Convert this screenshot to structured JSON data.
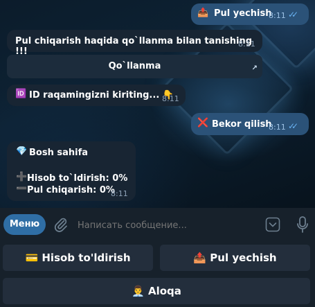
{
  "messages": {
    "pul_yechish": {
      "emoji": "📤",
      "text": "Pul yechish",
      "time": "8:11",
      "status": "✓✓"
    },
    "qollanma_info": {
      "text": "Pul chiqarish haqida qo`llanma bilan tanishing !!!",
      "time": "8:11",
      "button": "Qo`llanma",
      "button_icon": "↗"
    },
    "id_prompt": {
      "emoji": "🆔",
      "text": "ID raqamingizni kiriting... 👇",
      "time": "8:11"
    },
    "bekor": {
      "emoji": "❌",
      "text": "Bekor qilish",
      "time": "8:11",
      "status": "✓✓"
    },
    "bosh_sahifa": {
      "title_emoji": "💎",
      "title": "Bosh sahifa",
      "line1_emoji": "➕",
      "line1": "Hisob to`ldirish: 0%",
      "line2_emoji": "➖",
      "line2": "Pul chiqarish: 0%",
      "time": "8:11"
    }
  },
  "input": {
    "menu_label": "Меню",
    "placeholder": "Написать сообщение..."
  },
  "keyboard": {
    "btn1": "💳 Hisob to'ldirish",
    "btn2": "📤 Pul yechish",
    "btn3": "👨‍💼 Aloqa"
  },
  "colors": {
    "outgoing": "#2b5278",
    "incoming": "#182533",
    "accent": "#2f6ea5",
    "background": "#17212b"
  }
}
